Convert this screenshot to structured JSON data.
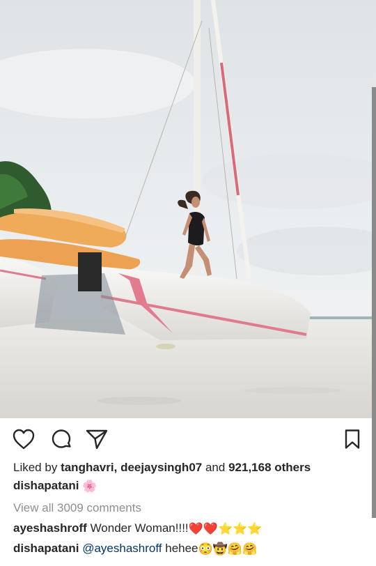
{
  "post": {
    "likes": {
      "prefix": "Liked by",
      "user1": "tanghavri",
      "sep": ",",
      "user2": "deejaysingh07",
      "and": "and",
      "count": "921,168 others"
    },
    "caption": {
      "username": "dishapatani",
      "flower_emoji": "🌸"
    },
    "view_all_comments": "View all 3009 comments",
    "comments": [
      {
        "username": "ayeshashroff",
        "text": "Wonder Woman!!!!",
        "emojis": "❤️❤️⭐⭐⭐"
      },
      {
        "username": "dishapatani",
        "mention": "@ayeshashroff",
        "text": "hehee",
        "emojis": "😳🤠🤗🤗"
      }
    ]
  },
  "icons": {
    "like": "heart-outline-icon",
    "comment": "speech-bubble-icon",
    "share": "paper-plane-icon",
    "save": "bookmark-icon"
  },
  "colors": {
    "text": "#262626",
    "muted": "#8e8e8e",
    "mention": "#00376b"
  }
}
